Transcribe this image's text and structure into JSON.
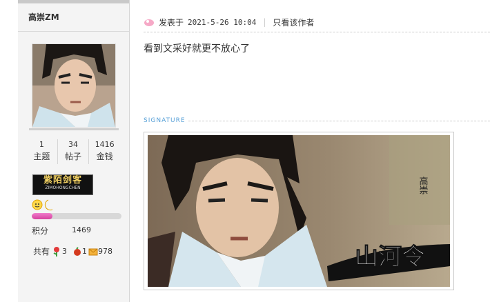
{
  "profile": {
    "username": "高崇ZM",
    "stats": [
      {
        "num": "1",
        "label": "主题"
      },
      {
        "num": "34",
        "label": "帖子"
      },
      {
        "num": "1416",
        "label": "金钱"
      }
    ],
    "medal": {
      "title": "紫陌剑客",
      "subtitle": "ZIMOHONGCHEN"
    },
    "level_progress": 0.23,
    "points_label": "积分",
    "points_value": "1469",
    "gifts_label": "共有",
    "gift_flower_count": "3",
    "gift_egg_count": "1",
    "gift_mail_count": "978"
  },
  "post": {
    "posted_label": "发表于",
    "datetime": "2021-5-26 10:04",
    "separator": "|",
    "only_author_link": "只看该作者",
    "content": "看到文采好就更不放心了"
  },
  "signature": {
    "label": "SIGNATURE",
    "title_art": "山河令",
    "vertical_text": "高崇"
  },
  "colors": {
    "accent": "#5aa2d8",
    "progress": "#e05bb8",
    "sidebar_bg": "#f4f4f4"
  }
}
